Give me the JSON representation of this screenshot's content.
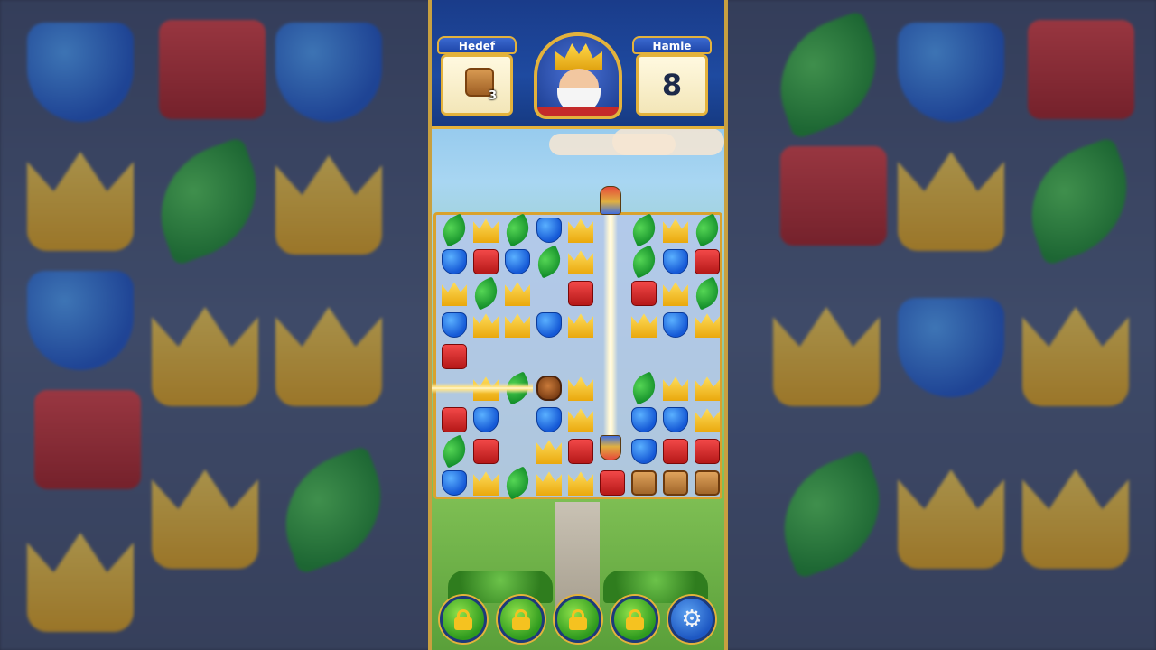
{
  "header": {
    "goal_label": "Hedef",
    "goal_icon": "wooden-box-icon",
    "goal_count": "3",
    "moves_label": "Hamle",
    "moves_value": "8"
  },
  "board": {
    "rows": [
      [
        "leaf",
        "crown",
        "leaf",
        "shield",
        "crown",
        "",
        "leaf",
        "crown",
        "leaf"
      ],
      [
        "shield",
        "book",
        "shield",
        "leaf",
        "crown",
        "",
        "leaf",
        "shield",
        "book"
      ],
      [
        "crown",
        "leaf",
        "crown",
        "",
        "book",
        "",
        "book",
        "crown",
        "leaf"
      ],
      [
        "shield",
        "crown",
        "crown",
        "shield",
        "crown",
        "",
        "crown",
        "shield",
        "crown"
      ],
      [
        "book",
        "",
        "",
        "",
        "",
        "",
        "",
        "",
        ""
      ],
      [
        "",
        "crown",
        "leaf",
        "barrel",
        "crown",
        "",
        "leaf",
        "crown",
        "crown"
      ],
      [
        "book",
        "shield",
        "",
        "shield",
        "crown",
        "",
        "shield",
        "shield",
        "crown"
      ],
      [
        "leaf",
        "book",
        "",
        "crown",
        "book",
        "",
        "shield",
        "book",
        "book"
      ],
      [
        "shield",
        "crown",
        "leaf",
        "crown",
        "crown",
        "book",
        "box",
        "box",
        "box"
      ]
    ]
  },
  "boosters": [
    {
      "icon": "lock-icon",
      "state": "locked"
    },
    {
      "icon": "lock-icon",
      "state": "locked"
    },
    {
      "icon": "lock-icon",
      "state": "locked"
    },
    {
      "icon": "lock-icon",
      "state": "locked"
    }
  ],
  "settings_icon": "gear-icon",
  "colors": {
    "frame_gold": "#e3b23c",
    "header_blue": "#1e4aa0",
    "button_green": "#2e9a1e"
  }
}
